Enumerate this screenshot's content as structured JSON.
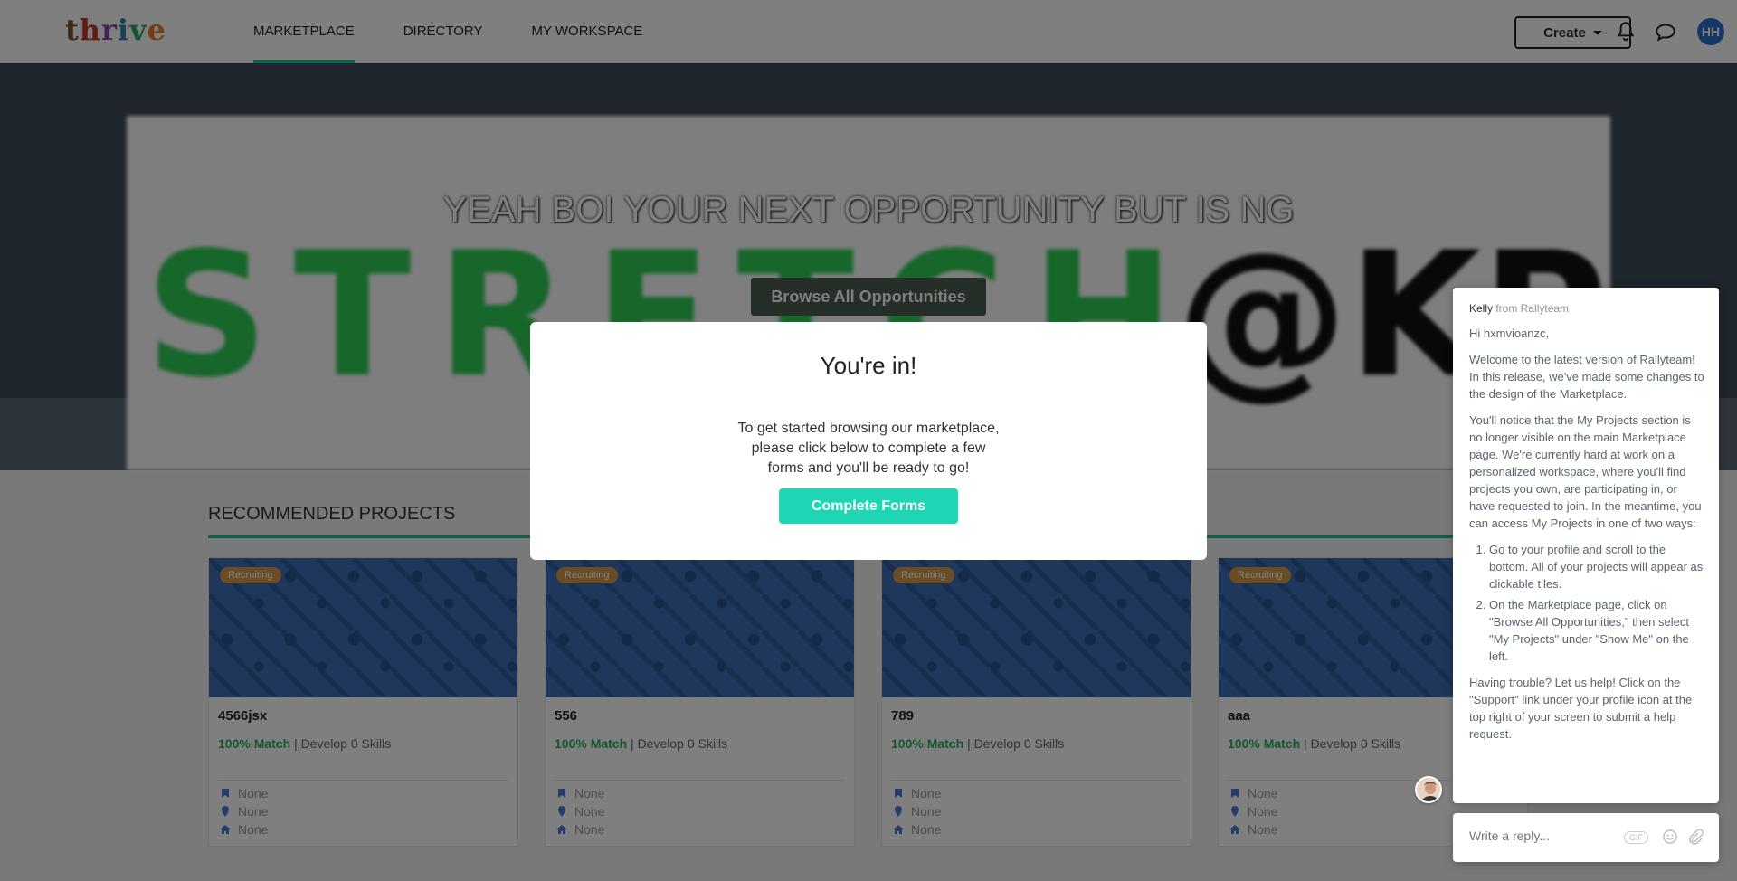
{
  "header": {
    "logo": [
      "t",
      "h",
      "r",
      "i",
      "v",
      "e"
    ],
    "nav": [
      {
        "label": "MARKETPLACE",
        "active": true
      },
      {
        "label": "DIRECTORY",
        "active": false
      },
      {
        "label": "MY WORKSPACE",
        "active": false
      }
    ],
    "create_label": "Create",
    "avatar_initials": "HH"
  },
  "hero": {
    "title": "YEAH BOI YOUR NEXT OPPORTUNITY BUT IS NG",
    "browse_label": "Browse All Opportunities",
    "banner_word": "STRETCH",
    "banner_at": "@KP"
  },
  "recommended": {
    "title": "RECOMMENDED PROJECTS",
    "cards": [
      {
        "badge": "Recruiting",
        "name": "4566jsx",
        "match": "100% Match",
        "develop": " | Develop 0 Skills",
        "dept": "None",
        "location": "None",
        "home": "None"
      },
      {
        "badge": "Recruiting",
        "name": "556",
        "match": "100% Match",
        "develop": " | Develop 0 Skills",
        "dept": "None",
        "location": "None",
        "home": "None"
      },
      {
        "badge": "Recruiting",
        "name": "789",
        "match": "100% Match",
        "develop": " | Develop 0 Skills",
        "dept": "None",
        "location": "None",
        "home": "None"
      },
      {
        "badge": "Recruiting",
        "name": "aaa",
        "match": "100% Match",
        "develop": " | Develop 0 Skills",
        "dept": "None",
        "location": "None",
        "home": "None"
      }
    ]
  },
  "modal": {
    "title": "You're in!",
    "body": "To get started browsing our marketplace, please click below to complete a few forms and you'll be ready to go!",
    "button": "Complete Forms"
  },
  "chat": {
    "sender": "Kelly",
    "from": " from Rallyteam",
    "greeting": "Hi hxmvioanzc,",
    "p1": "Welcome to the latest version of Rallyteam! In this release, we've made some changes to the design of the Marketplace.",
    "p2": "You'll notice that the My Projects section is no longer visible on the main Marketplace page. We're currently hard at work on a personalized workspace, where you'll find projects you own, are participating in, or have requested to join. In the meantime, you can access My Projects in one of two ways:",
    "li1": "Go to your profile and scroll to the bottom. All of your projects will appear as clickable tiles.",
    "li2": "On the Marketplace page, click on \"Browse All Opportunities,\" then select \"My Projects\" under \"Show Me\" on the left.",
    "p3": "Having trouble? Let us help! Click on the \"Support\" link under your profile icon at the top right of your screen to submit a help request.",
    "reply_placeholder": "Write a reply...",
    "gif_label": "GIF"
  },
  "colors": {
    "accent": "#1abc9c",
    "match_green": "#27ae60",
    "badge": "#d79a4a",
    "modal_button": "#1fd6b4"
  }
}
